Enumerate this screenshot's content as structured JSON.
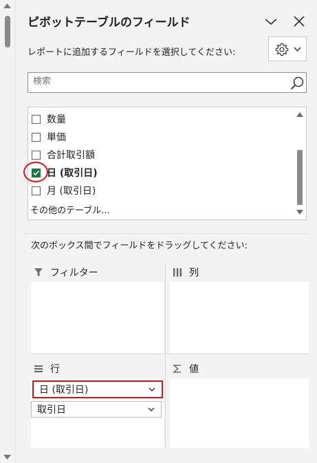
{
  "panel": {
    "title": "ピボットテーブルのフィールド",
    "instruction": "レポートに追加するフィールドを選択してください:",
    "drag_instruction": "次のボックス間でフィールドをドラッグしてください:"
  },
  "search": {
    "placeholder": "検索"
  },
  "fields": [
    {
      "label": "数量",
      "checked": false,
      "bold": false
    },
    {
      "label": "単価",
      "checked": false,
      "bold": false
    },
    {
      "label": "合計取引額",
      "checked": false,
      "bold": false
    },
    {
      "label": "日 (取引日)",
      "checked": true,
      "bold": true
    },
    {
      "label": "月 (取引日)",
      "checked": false,
      "bold": false
    }
  ],
  "more_tables": "その他のテーブル...",
  "areas": {
    "filter": {
      "label": "フィルター",
      "icon": "filter-icon"
    },
    "columns": {
      "label": "列",
      "icon": "columns-icon"
    },
    "rows": {
      "label": "行",
      "icon": "rows-icon",
      "items": [
        "日 (取引日)",
        "取引日"
      ]
    },
    "values": {
      "label": "値",
      "icon": "sigma-icon"
    }
  },
  "colors": {
    "accent": "#217346",
    "highlight": "#d8131b"
  }
}
